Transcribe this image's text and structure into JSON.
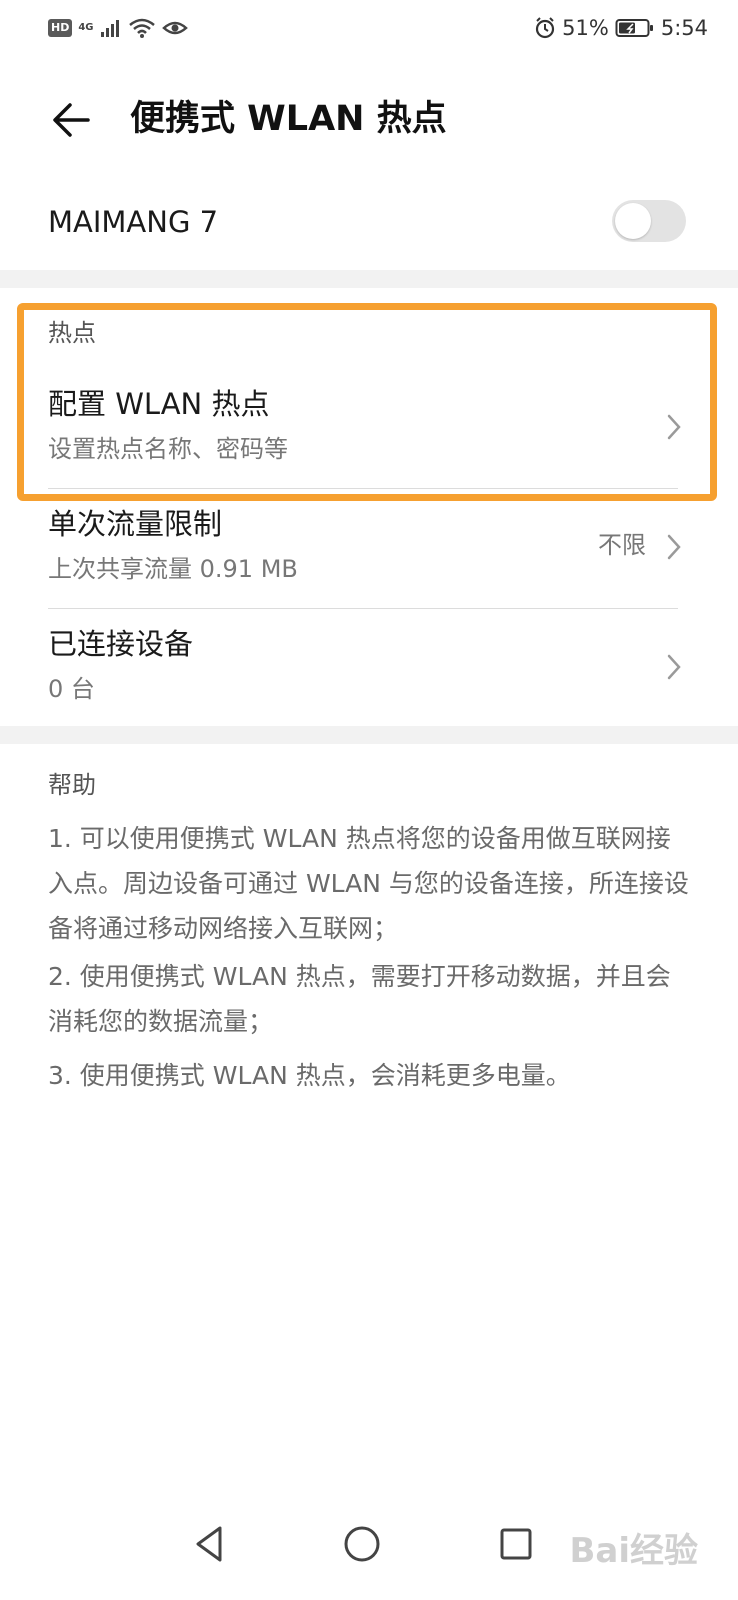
{
  "status_bar": {
    "hd_badge": "HD",
    "network_type": "4G",
    "battery_percent": "51%",
    "time": "5:54",
    "icons": [
      "hd-icon",
      "cellular-signal-icon",
      "wifi-icon",
      "eye-icon",
      "alarm-icon",
      "battery-icon"
    ]
  },
  "header": {
    "title": "便携式 WLAN 热点",
    "back_icon": "arrow-left-icon"
  },
  "hotspot": {
    "name": "MAIMANG 7",
    "enabled": false
  },
  "section": {
    "header": "热点",
    "items": [
      {
        "title": "配置 WLAN 热点",
        "subtitle": "设置热点名称、密码等",
        "value": ""
      },
      {
        "title": "单次流量限制",
        "subtitle": "上次共享流量 0.91 MB",
        "value": "不限"
      },
      {
        "title": "已连接设备",
        "subtitle": "0 台",
        "value": ""
      }
    ]
  },
  "help": {
    "title": "帮助",
    "paragraphs": [
      "1. 可以使用便携式 WLAN 热点将您的设备用做互联网接入点。周边设备可通过 WLAN 与您的设备连接，所连接设备将通过移动网络接入互联网；",
      "2. 使用便携式 WLAN 热点，需要打开移动数据，并且会消耗您的数据流量；",
      "3. 使用便携式 WLAN 热点，会消耗更多电量。"
    ]
  },
  "nav": {
    "icons": [
      "back-triangle-icon",
      "home-circle-icon",
      "recents-square-icon"
    ]
  },
  "watermark": "Bai经验",
  "colors": {
    "highlight": "#f6a030",
    "toggle_off": "#e3e3e3",
    "band": "#f2f2f2"
  }
}
